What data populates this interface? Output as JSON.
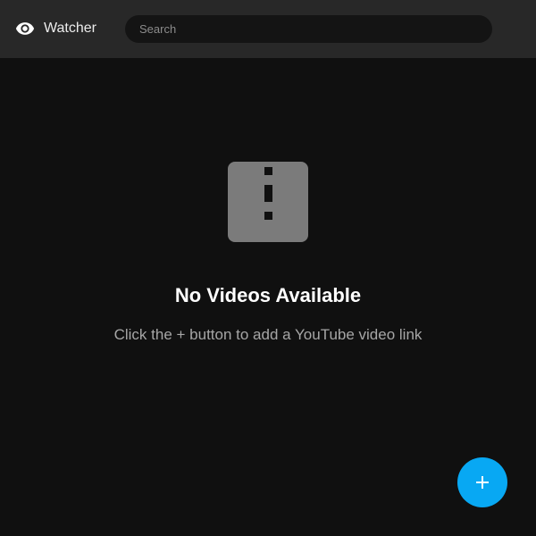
{
  "header": {
    "app_name": "Watcher",
    "logo_icon": "eye-icon",
    "search": {
      "placeholder": "Search",
      "value": ""
    }
  },
  "empty_state": {
    "icon": "alert-icon",
    "title": "No Videos Available",
    "subtitle": "Click the + button to add a YouTube video link"
  },
  "fab": {
    "icon": "plus-icon",
    "color": "#08a8f3"
  },
  "colors": {
    "background": "#101010",
    "header": "#282828",
    "accent": "#08a8f3"
  }
}
